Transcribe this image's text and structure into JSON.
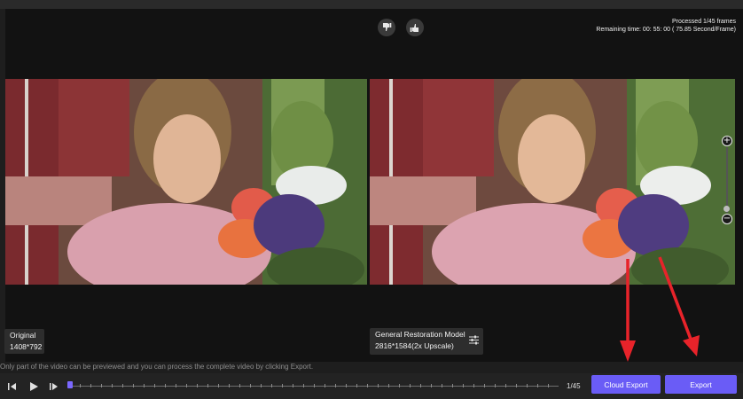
{
  "status": {
    "processed": "Processed 1/45 frames",
    "remaining": "Remaining time: 00: 55: 00 ( 75.85 Second/Frame)"
  },
  "feedback": {
    "dislike_icon": "thumbs-down-icon",
    "like_icon": "thumbs-up-icon"
  },
  "original": {
    "label": "Original",
    "resolution": "1408*792"
  },
  "output": {
    "model": "General Restoration Model",
    "resolution": "2816*1584(2x Upscale)",
    "settings_icon": "sliders-icon"
  },
  "zoom": {
    "in_symbol": "+",
    "out_symbol": "−"
  },
  "hint": "Only part of the video can be previewed and you can process the complete video by clicking Export.",
  "playback": {
    "prev_icon": "skip-back-icon",
    "play_icon": "play-icon",
    "next_icon": "skip-forward-icon",
    "frame_counter": "1/45",
    "current_frame": 1,
    "total_frames": 45
  },
  "actions": {
    "cloud_export": "Cloud Export",
    "export": "Export"
  },
  "colors": {
    "accent": "#6a5cf6",
    "annotation_arrow": "#e8232a"
  }
}
